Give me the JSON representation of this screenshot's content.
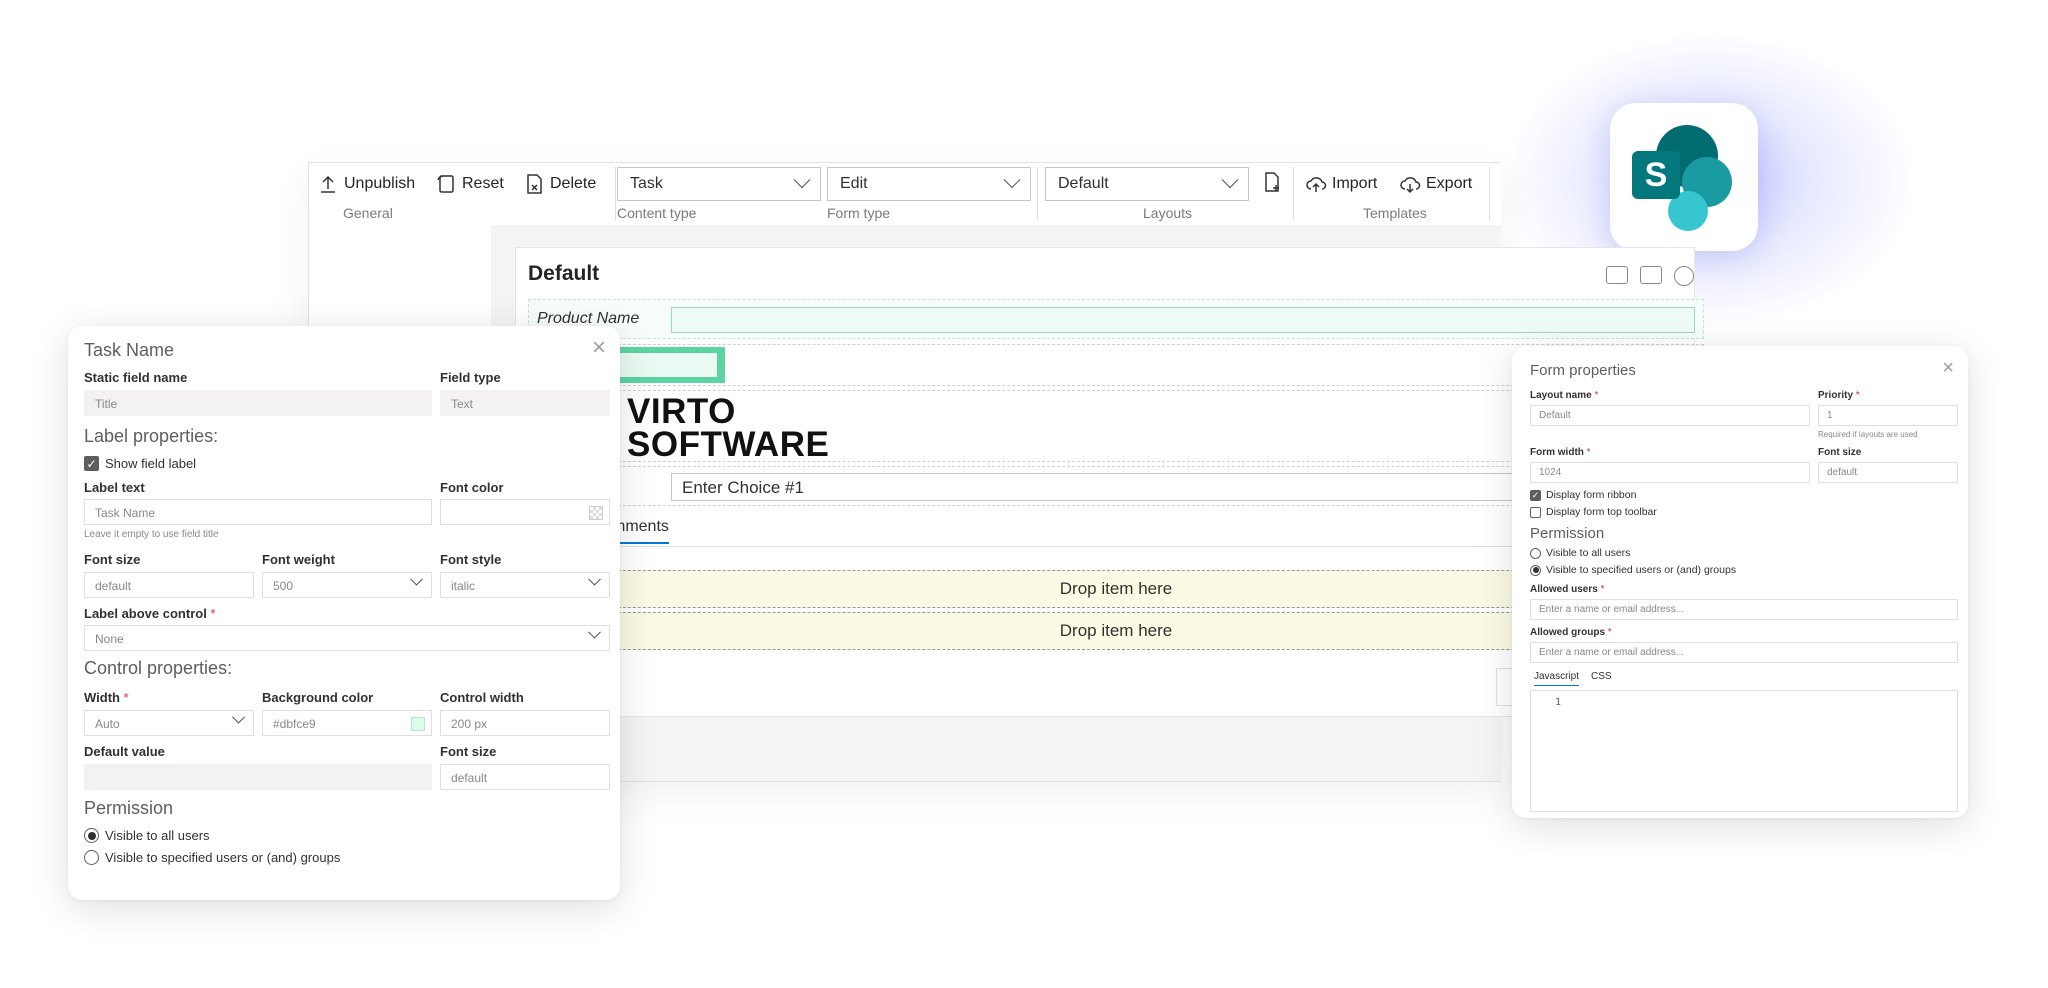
{
  "ribbon": {
    "unpublish_label": "Unpublish",
    "reset_label": "Reset",
    "delete_label": "Delete",
    "group_general": "General",
    "content_type_value": "Task",
    "group_content_type": "Content type",
    "form_type_value": "Edit",
    "group_form_type": "Form type",
    "layout_value": "Default",
    "group_layouts": "Layouts",
    "import_label": "Import",
    "export_label": "Export",
    "group_templates": "Templates"
  },
  "form": {
    "title": "Default",
    "product_label": "Product Name",
    "logo_line1": "VIRTO",
    "logo_line2": "SOFTWARE",
    "choice_placeholder": "Enter Choice #1",
    "tab_comments": "mments",
    "drop_1": "Drop item here",
    "drop_2": "Drop item here"
  },
  "field_panel": {
    "title": "Task Name",
    "static_field_name_label": "Static field name",
    "static_field_name_value": "Title",
    "field_type_label": "Field type",
    "field_type_value": "Text",
    "label_props_heading": "Label properties:",
    "show_field_label": "Show field label",
    "label_text_label": "Label text",
    "label_text_placeholder": "Task Name",
    "label_text_hint": "Leave it empty to use field title",
    "font_color_label": "Font color",
    "font_size_label": "Font size",
    "font_size_value": "default",
    "font_weight_label": "Font weight",
    "font_weight_value": "500",
    "font_style_label": "Font style",
    "font_style_value": "italic",
    "label_above_label": "Label above control",
    "label_above_value": "None",
    "control_props_heading": "Control properties:",
    "width_label": "Width",
    "width_value": "Auto",
    "bg_color_label": "Background color",
    "bg_color_value": "#dbfce9",
    "control_width_label": "Control width",
    "control_width_value": "200",
    "control_width_unit": "px",
    "default_value_label": "Default value",
    "font_size2_label": "Font size",
    "font_size2_value": "default",
    "permission_heading": "Permission",
    "perm_all": "Visible to all users",
    "perm_specified": "Visible to specified users or (and) groups"
  },
  "form_panel": {
    "title": "Form properties",
    "layout_name_label": "Layout name",
    "layout_name_value": "Default",
    "priority_label": "Priority",
    "priority_value": "1",
    "priority_hint": "Required if layouts are used",
    "form_width_label": "Form width",
    "form_width_value": "1024",
    "font_size_label": "Font size",
    "font_size_value": "default",
    "display_ribbon": "Display form ribbon",
    "display_toolbar": "Display form top toolbar",
    "permission_heading": "Permission",
    "perm_all": "Visible to all users",
    "perm_specified": "Visible to specified users or (and) groups",
    "allowed_users_label": "Allowed users",
    "allowed_users_placeholder": "Enter a name or email address...",
    "allowed_groups_label": "Allowed groups",
    "allowed_groups_placeholder": "Enter a name or email address...",
    "tab_js": "Javascript",
    "tab_css": "CSS",
    "code_line": "1"
  },
  "colors": {
    "accent": "#0078d4",
    "green": "#5cd4a2",
    "bg_swatch": "#dbfce9",
    "sharepoint": "#036c70"
  }
}
